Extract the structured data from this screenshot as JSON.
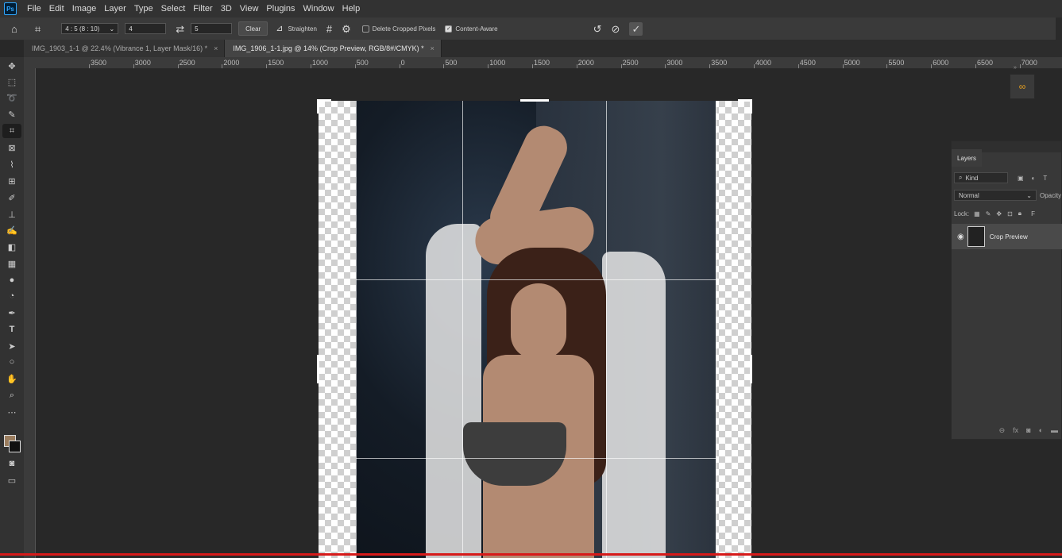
{
  "menu": [
    "File",
    "Edit",
    "Image",
    "Layer",
    "Type",
    "Select",
    "Filter",
    "3D",
    "View",
    "Plugins",
    "Window",
    "Help"
  ],
  "options": {
    "ratio": "4 : 5 (8 : 10)",
    "width": "4",
    "height": "5",
    "clear_label": "Clear",
    "straighten_label": "Straighten",
    "delete_cropped_label": "Delete Cropped Pixels",
    "delete_cropped_checked": false,
    "content_aware_label": "Content-Aware",
    "content_aware_checked": true
  },
  "tabs": [
    {
      "label": "IMG_1903_1-1 @ 22.4% (Vibrance 1, Layer Mask/16) *",
      "active": false
    },
    {
      "label": "IMG_1906_1-1.jpg @ 14% (Crop Preview, RGB/8#/CMYK) *",
      "active": true
    }
  ],
  "ruler_labels": [
    "3500",
    "3000",
    "2500",
    "2000",
    "1500",
    "1000",
    "500",
    "0",
    "500",
    "1000",
    "1500",
    "2000",
    "2500",
    "3000",
    "3500",
    "4000",
    "4500",
    "5000",
    "5500",
    "6000",
    "6500",
    "7000",
    "7500"
  ],
  "colors": {
    "foreground": "#9b7d5e",
    "background": "#111111"
  },
  "layers": {
    "tab_label": "Layers",
    "kind_placeholder": "Kind",
    "blend_mode": "Normal",
    "opacity_label": "Opacity",
    "lock_label": "Lock:",
    "fill_label": "F",
    "layer_items": [
      {
        "name": "Crop Preview",
        "visible": true
      }
    ]
  }
}
